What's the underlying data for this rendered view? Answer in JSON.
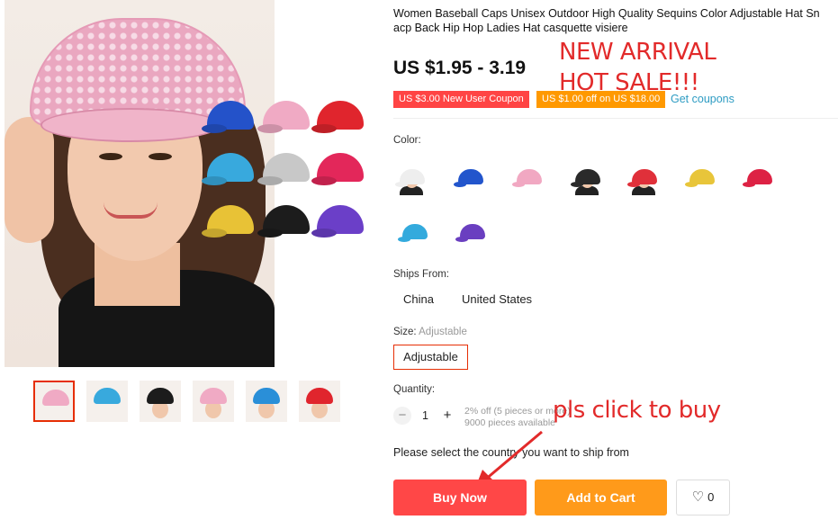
{
  "product": {
    "title_line1": "Women Baseball Caps Unisex Outdoor High Quality Sequins Color Adjustable Hat Sn",
    "title_line2": "acp Back Hip Hop Ladies Hat casquette visiere",
    "price": "US $1.95 - 3.19"
  },
  "annotations": {
    "new_arrival": "NEW ARRIVAL",
    "hot_sale": "HOT SALE!!!",
    "click_to_buy": "pls click to buy"
  },
  "coupons": {
    "new_user": "US $3.00 New User Coupon",
    "off": "US $1.00 off on US $18.00",
    "get_coupons": "Get coupons"
  },
  "color": {
    "label": "Color:",
    "swatches": [
      {
        "icon": "model-white-cap-icon",
        "color": "#eeeeee"
      },
      {
        "icon": "blue-cap-icon",
        "color": "#2255cc"
      },
      {
        "icon": "pink-cap-icon",
        "color": "#f1a8c2"
      },
      {
        "icon": "model-black-cap-icon",
        "color": "#2a2a2a"
      },
      {
        "icon": "model-red-cap-icon",
        "color": "#e0303a"
      },
      {
        "icon": "gold-cap-icon",
        "color": "#e8c53a"
      },
      {
        "icon": "red-cap-icon",
        "color": "#dd2244"
      },
      {
        "icon": "sky-blue-cap-icon",
        "color": "#33aadd"
      },
      {
        "icon": "purple-cap-icon",
        "color": "#6a3fc0"
      }
    ]
  },
  "ships_from": {
    "label": "Ships From:",
    "options": [
      "China",
      "United States"
    ]
  },
  "size": {
    "label": "Size:",
    "selected": "Adjustable",
    "option": "Adjustable"
  },
  "quantity": {
    "label": "Quantity:",
    "minus": "−",
    "value": "1",
    "plus": "+",
    "discount": "2% off (5 pieces or more)",
    "available": "9000 pieces available"
  },
  "ship_message": "Please select the country you want to ship from",
  "actions": {
    "buy_now": "Buy Now",
    "add_to_cart": "Add to Cart",
    "wishlist_count": "0"
  },
  "gallery": {
    "main_cap_colors": [
      "#2452c9",
      "#f0aac4",
      "#e0252d",
      "#38a9dd",
      "#c8c8c8",
      "#e3275a",
      "#e8c236",
      "#1c1c1c",
      "#6b3fc8"
    ],
    "thumb_colors": [
      "#f0aac4",
      "#38a9dd",
      "#1c1c1c",
      "#f0aac4",
      "#2a8fd8",
      "#e0252d"
    ]
  },
  "theme": {
    "accent": "#e62e04",
    "buy": "#ff4747",
    "cart": "#ff9a1a",
    "link": "#2e9cc3"
  }
}
